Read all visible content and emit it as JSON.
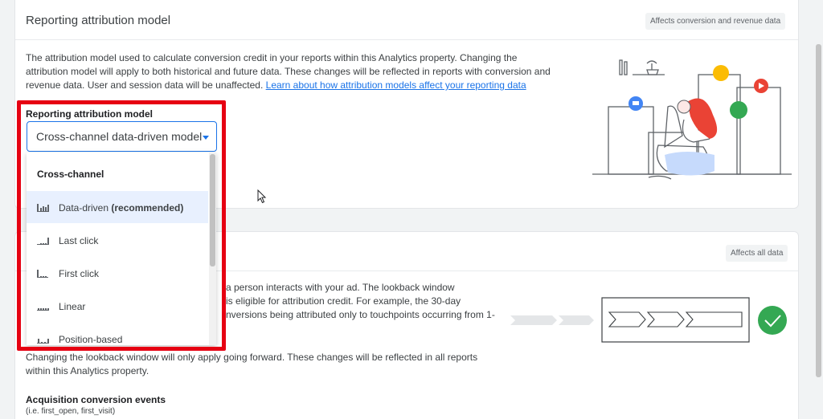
{
  "attribution_card": {
    "title": "Reporting attribution model",
    "badge": "Affects conversion and revenue data",
    "description_lines": [
      "The attribution model used to calculate conversion credit in your reports within this Analytics property. Changing the",
      "attribution model will apply to both historical and future data. These changes will be reflected in reports with conversion and"
    ],
    "description_last_prefix": "revenue data. User and session data will be unaffected. ",
    "learn_link": "Learn about how attribution models affect your reporting data",
    "field_label": "Reporting attribution model",
    "selected_value": "Cross-channel data-driven model"
  },
  "dropdown": {
    "group_header": "Cross-channel",
    "items": [
      {
        "label": "Data-driven",
        "suffix": " (recommended)",
        "icon": "bar-chart-data-driven-icon"
      },
      {
        "label": "Last click",
        "suffix": "",
        "icon": "bar-chart-last-click-icon"
      },
      {
        "label": "First click",
        "suffix": "",
        "icon": "bar-chart-first-click-icon"
      },
      {
        "label": "Linear",
        "suffix": "",
        "icon": "bar-chart-linear-icon"
      },
      {
        "label": "Position-based",
        "suffix": "",
        "icon": "bar-chart-position-based-icon"
      }
    ],
    "selected_index": 0
  },
  "lookback_card": {
    "badge": "Affects all data",
    "partial_lines": [
      "a person interacts with your ad. The lookback window",
      "is eligible for attribution credit. For example, the 30-day",
      "nversions being attributed only to touchpoints occurring from 1-"
    ],
    "note_lines": [
      "Changing the lookback window will only apply going forward. These changes will be reflected in all reports",
      "within this Analytics property."
    ],
    "section_label": "Acquisition conversion events",
    "section_hint": "(i.e. first_open, first_visit)"
  },
  "colors": {
    "accent": "#1a73e8",
    "highlight": "#e60012",
    "selected_bg": "#e8f0fe",
    "check_green": "#34a853"
  }
}
